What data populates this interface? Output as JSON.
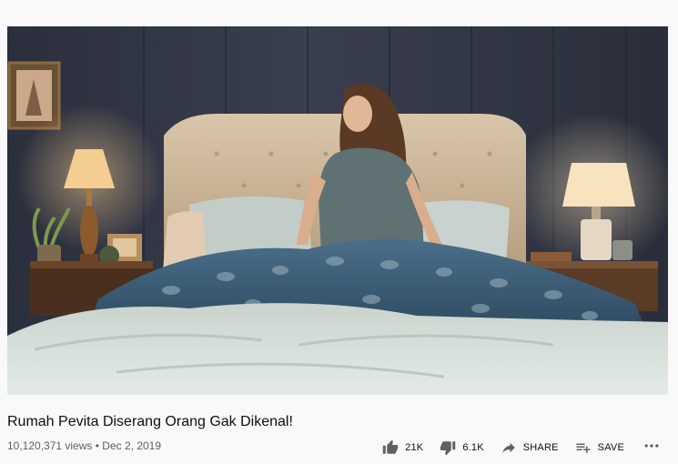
{
  "video": {
    "title": "Rumah Pevita Diserang Orang Gak Dikenal!",
    "views": "10,120,371 views",
    "separator": "•",
    "date": "Dec 2, 2019",
    "thumbnail_icon": "video-frame-bedroom-scene"
  },
  "actions": {
    "like": {
      "label": "21K",
      "icon": "thumbs-up-icon"
    },
    "dislike": {
      "label": "6.1K",
      "icon": "thumbs-down-icon"
    },
    "share": {
      "label": "SHARE",
      "icon": "share-arrow-icon"
    },
    "save": {
      "label": "SAVE",
      "icon": "playlist-add-icon"
    },
    "more": {
      "icon": "more-horizontal-icon"
    }
  },
  "colors": {
    "background": "#f9f9f9",
    "text_primary": "#0f0f0f",
    "text_secondary": "#606060",
    "icon": "#606060"
  }
}
